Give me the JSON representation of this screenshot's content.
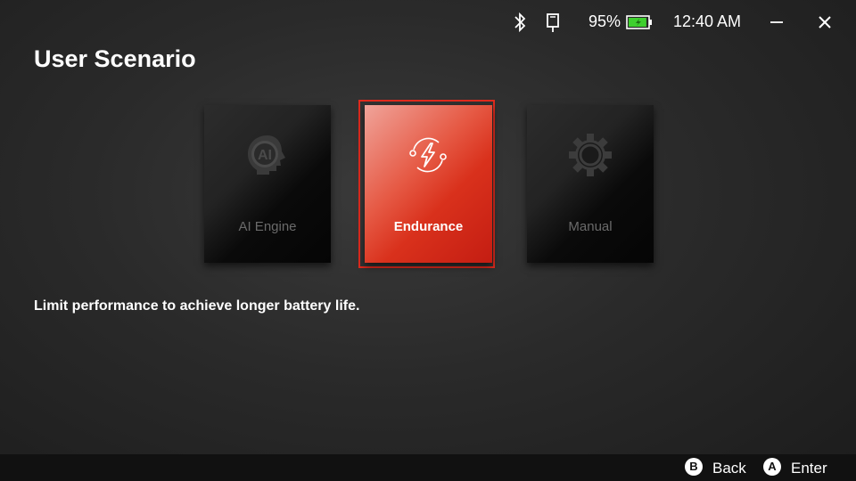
{
  "status_bar": {
    "bluetooth_icon": "bluetooth-icon",
    "device_icon": "device-sd-card-icon",
    "battery_percent": "95%",
    "battery_level": 0.95,
    "battery_color": "#3ecf2e",
    "time": "12:40 AM",
    "minimize_icon": "minimize-icon",
    "close_icon": "close-icon"
  },
  "page": {
    "title": "User Scenario",
    "description": "Limit performance to achieve longer battery life."
  },
  "scenarios": [
    {
      "label": "AI Engine",
      "icon": "ai-engine-icon",
      "selected": false
    },
    {
      "label": "Endurance",
      "icon": "endurance-icon",
      "selected": true
    },
    {
      "label": "Manual",
      "icon": "gear-icon",
      "selected": false
    }
  ],
  "colors": {
    "accent": "#e02a1d",
    "selected_card": "#d9311c",
    "background": "#2a2a2a"
  },
  "footer": {
    "back": {
      "glyph": "B",
      "label": "Back"
    },
    "enter": {
      "glyph": "A",
      "label": "Enter"
    }
  }
}
